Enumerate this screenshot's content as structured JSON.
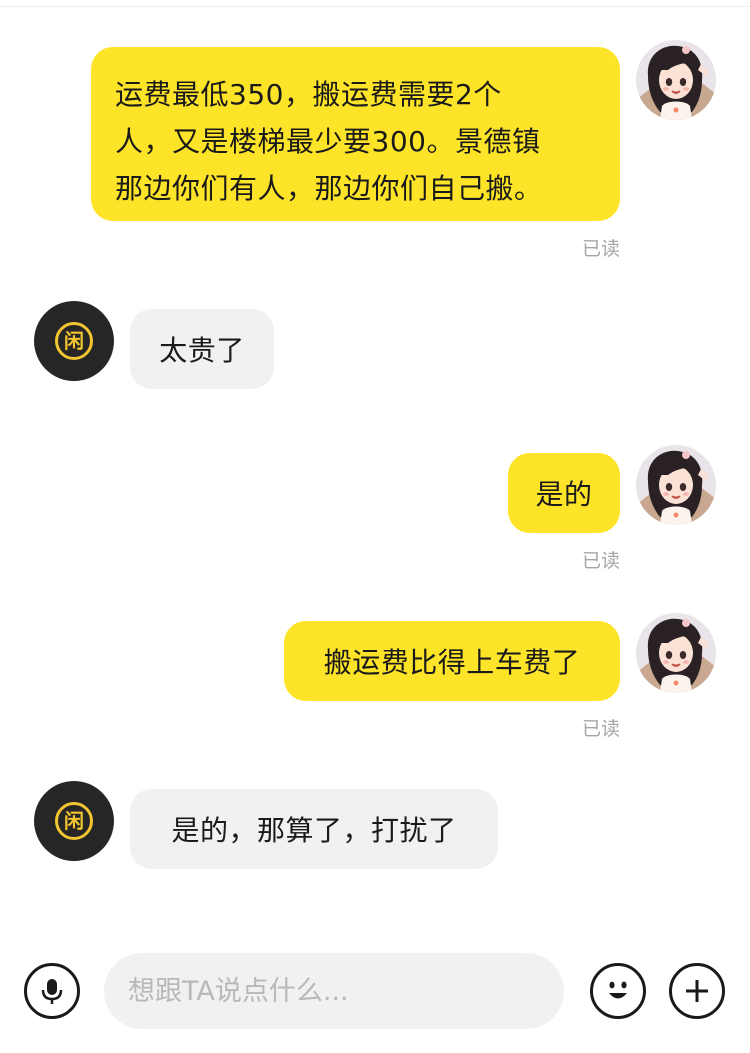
{
  "messages": [
    {
      "direction": "outgoing",
      "lines": [
        "运费最低350，搬运费需要2个",
        "人，又是楼梯最少要300。景德镇",
        "那边你们有人，那边你们自己搬。"
      ],
      "read_status": "已读"
    },
    {
      "direction": "incoming",
      "text": "太贵了"
    },
    {
      "direction": "outgoing",
      "text": "是的",
      "read_status": "已读"
    },
    {
      "direction": "outgoing",
      "text": "搬运费比得上车费了",
      "read_status": "已读"
    },
    {
      "direction": "incoming",
      "text": "是的，那算了，打扰了"
    }
  ],
  "shop_avatar": {
    "logo_char": "闲",
    "logo_color": "#f3c531",
    "background": "#262626"
  },
  "user_avatar": {
    "icon": "anime-girl-avatar"
  },
  "colors": {
    "outgoing_bubble": "#fde428",
    "incoming_bubble": "#f1f1f3",
    "read_text": "#a6a6a6"
  },
  "input_bar": {
    "placeholder": "想跟TA说点什么...",
    "voice_icon": "microphone-icon",
    "emoji_icon": "emoji-icon",
    "add_icon": "plus-icon"
  }
}
